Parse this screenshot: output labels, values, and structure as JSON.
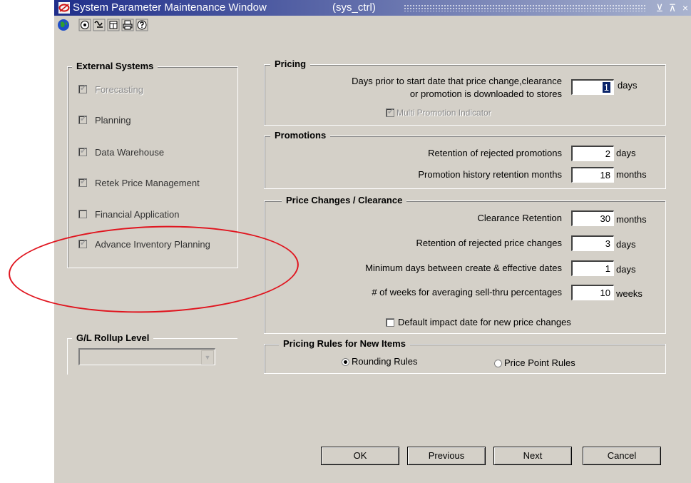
{
  "window": {
    "title": "System Parameter Maintenance Window",
    "module": "(sys_ctrl)",
    "minimize_glyph": "⊻",
    "restore_glyph": "⊼",
    "close_glyph": "×"
  },
  "toolbar": {
    "icons": [
      "globe-icon",
      "help-circle-icon",
      "wave-icon",
      "window-icon",
      "print-icon",
      "question-icon"
    ]
  },
  "external_systems": {
    "title": "External Systems",
    "items": [
      {
        "label": "Forecasting",
        "checked": true,
        "enabled": false
      },
      {
        "label": "Planning",
        "checked": true,
        "enabled": false
      },
      {
        "label": "Data Warehouse",
        "checked": true,
        "enabled": false
      },
      {
        "label": "Retek Price Management",
        "checked": true,
        "enabled": false
      },
      {
        "label": "Financial Application",
        "checked": false,
        "enabled": false
      },
      {
        "label": "Advance Inventory Planning",
        "checked": true,
        "enabled": false
      }
    ]
  },
  "gl_rollup": {
    "title": "G/L Rollup Level",
    "value": ""
  },
  "pricing": {
    "title": "Pricing",
    "days_prior_label_line1": "Days prior to start date that price change,clearance",
    "days_prior_label_line2": "or promotion is downloaded to stores",
    "days_prior_value": "1",
    "days_prior_unit": "days",
    "multi_promo_label": "Multi Promotion Indicator"
  },
  "promotions": {
    "title": "Promotions",
    "rows": [
      {
        "label": "Retention of rejected promotions",
        "value": "2",
        "unit": "days"
      },
      {
        "label": "Promotion history retention months",
        "value": "18",
        "unit": "months"
      }
    ]
  },
  "price_changes": {
    "title": "Price Changes / Clearance",
    "rows": [
      {
        "label": "Clearance Retention",
        "value": "30",
        "unit": "months"
      },
      {
        "label": "Retention of rejected price changes",
        "value": "3",
        "unit": "days"
      },
      {
        "label": "Minimum days between create & effective dates",
        "value": "1",
        "unit": "days"
      },
      {
        "label": "# of weeks for averaging sell-thru percentages",
        "value": "10",
        "unit": "weeks"
      }
    ],
    "default_impact_label": "Default impact date for new price changes"
  },
  "pricing_rules": {
    "title": "Pricing Rules for New Items",
    "rounding_label": "Rounding Rules",
    "price_point_label": "Price Point Rules",
    "selected": "rounding"
  },
  "buttons": {
    "ok": "OK",
    "previous": "Previous",
    "next": "Next",
    "cancel": "Cancel"
  },
  "annotation_color": "#e0141e"
}
